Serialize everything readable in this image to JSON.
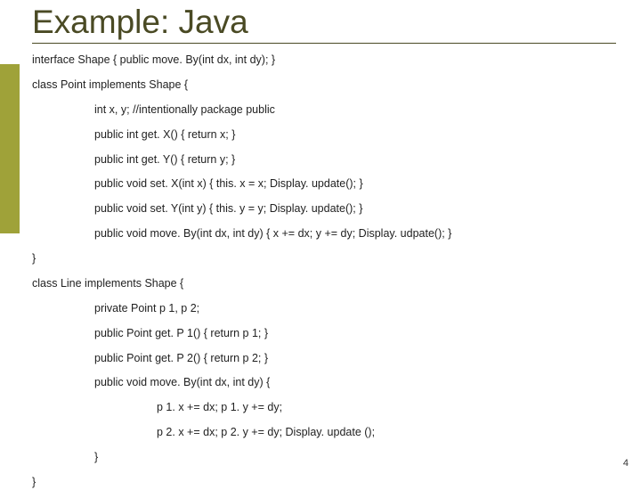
{
  "title": "Example: Java",
  "lines": [
    {
      "cls": "",
      "text": "interface Shape { public move. By(int dx, int dy); }"
    },
    {
      "cls": "",
      "text": "class Point implements Shape {"
    },
    {
      "cls": "indent1",
      "text": "int x, y; //intentionally package public"
    },
    {
      "cls": "indent1",
      "text": "public int get. X() { return x; }"
    },
    {
      "cls": "indent1",
      "text": "public int get. Y() { return y; }"
    },
    {
      "cls": "indent1",
      "text": "public void set. X(int x) { this. x = x; Display. update(); }"
    },
    {
      "cls": "indent1",
      "text": "public void set. Y(int y) { this. y = y; Display. update(); }"
    },
    {
      "cls": "indent1",
      "text": "public void move. By(int dx, int dy) { x += dx; y += dy; Display. udpate(); }"
    },
    {
      "cls": "",
      "text": "}"
    },
    {
      "cls": "",
      "text": "class Line implements Shape {"
    },
    {
      "cls": "indent1",
      "text": "private Point p 1, p 2;"
    },
    {
      "cls": "indent1",
      "text": "public Point get. P 1() { return p 1; }"
    },
    {
      "cls": "indent1",
      "text": "public Point get. P 2() { return p 2; }"
    },
    {
      "cls": "indent1",
      "text": "public void move. By(int dx, int dy) {"
    },
    {
      "cls": "indent2",
      "text": "p 1. x += dx; p 1. y += dy;"
    },
    {
      "cls": "indent2",
      "text": "p 2. x += dx; p 2. y += dy; Display. update ();"
    },
    {
      "cls": "indent1",
      "text": "}"
    },
    {
      "cls": "",
      "text": "}"
    }
  ],
  "pageNumber": "4"
}
